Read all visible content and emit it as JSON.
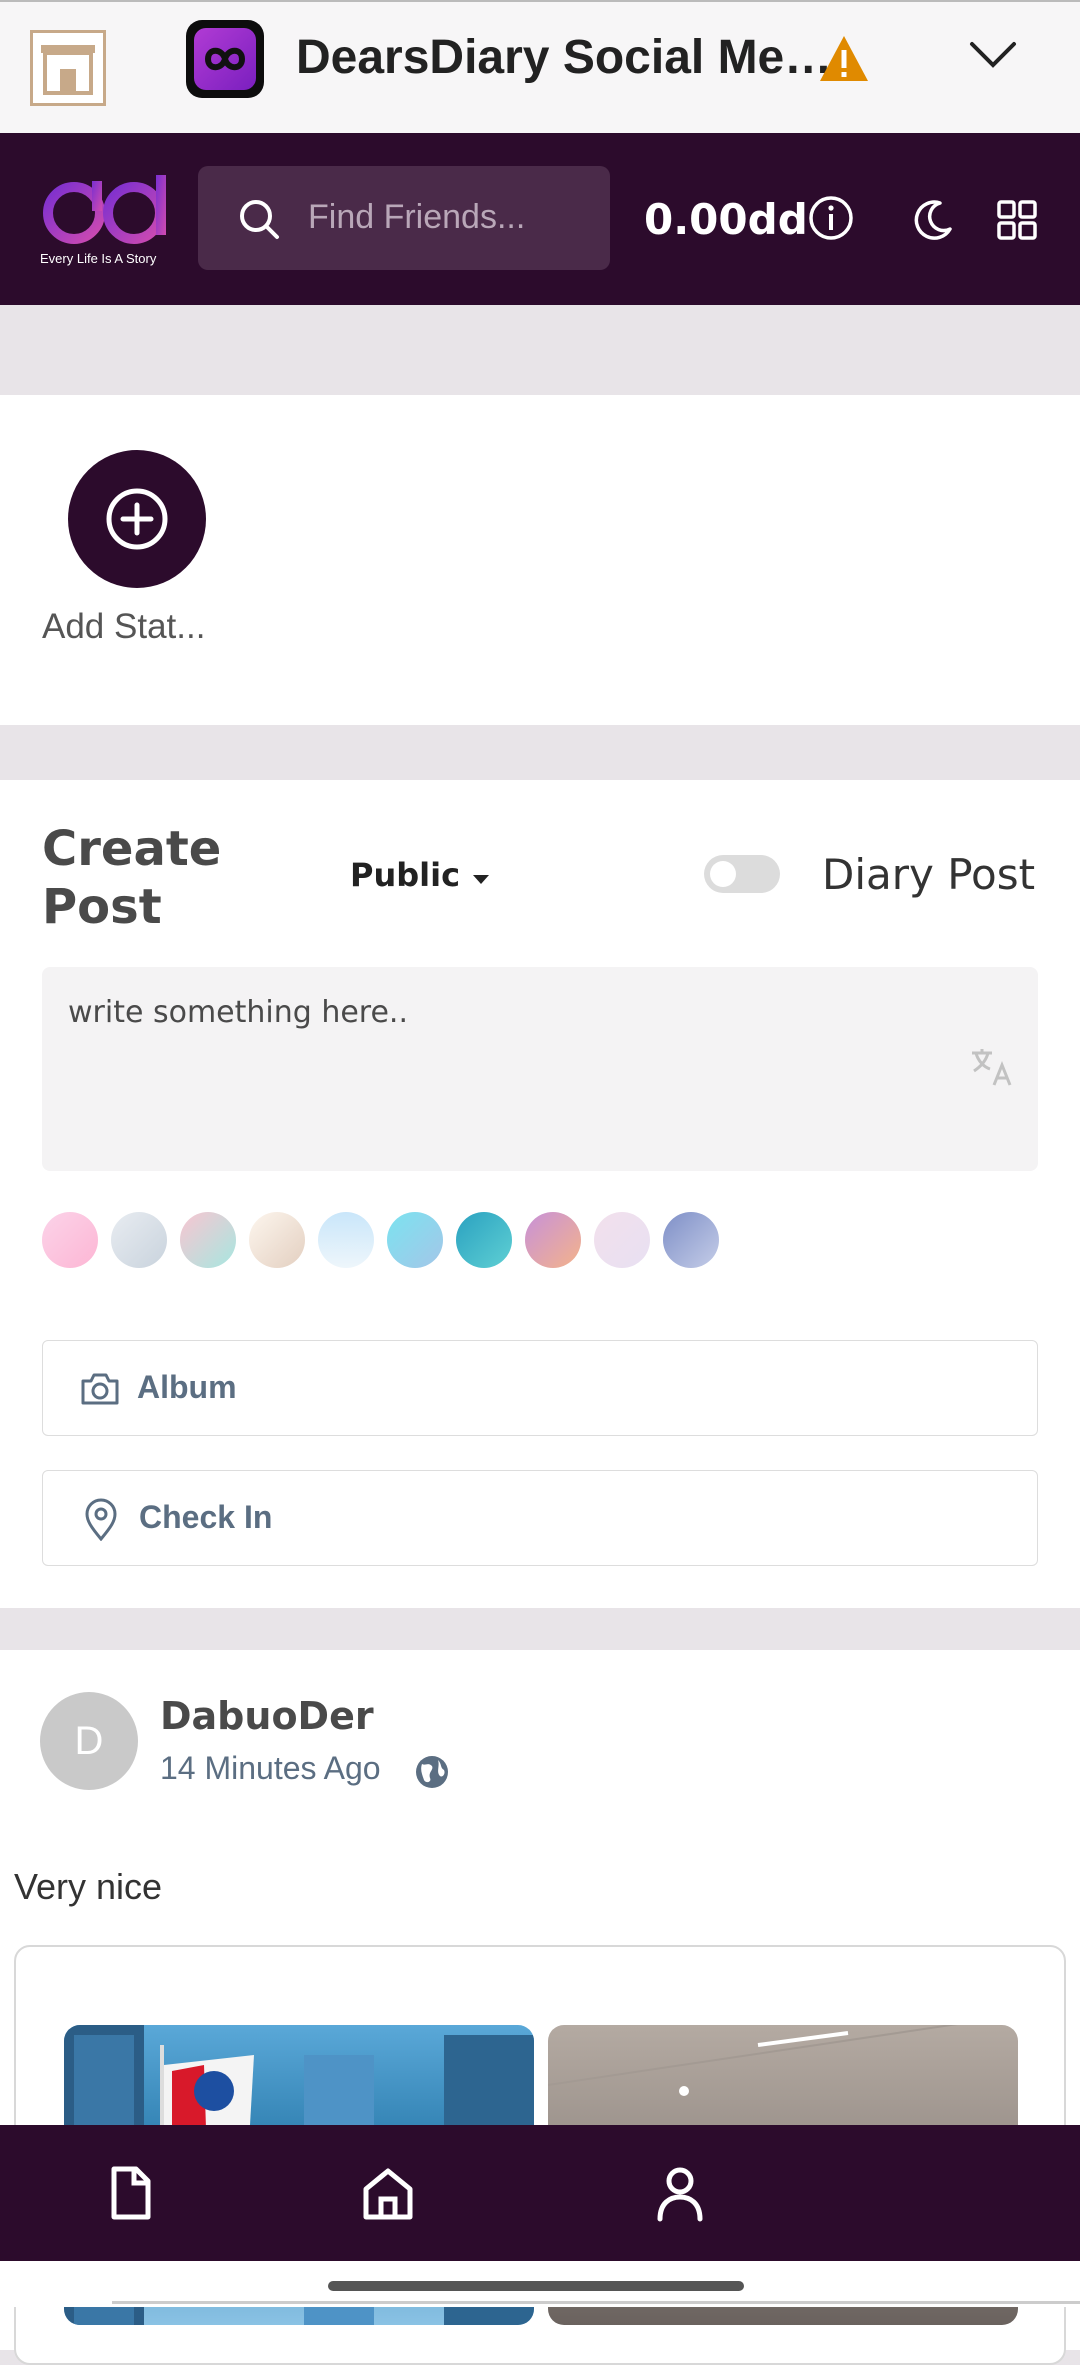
{
  "topbar": {
    "title": "DearsDiary Social Me…"
  },
  "header": {
    "logo_tagline": "Every Life Is A Story",
    "search_placeholder": "Find Friends...",
    "balance": "0.00dd"
  },
  "stories": {
    "add_label": "Add Stat..."
  },
  "create_post": {
    "title": "Create Post",
    "privacy_value": "Public",
    "diary_toggle_label": "Diary Post",
    "diary_toggle_on": false,
    "input_placeholder": "write something here..",
    "background_swatches": [
      "linear-gradient(135deg,#fbd3e9,#fdb6d4)",
      "linear-gradient(135deg,#e8ecf1,#c9d3dd)",
      "linear-gradient(135deg,#f9c5d1,#a6e7e0)",
      "linear-gradient(135deg,#fdf6ee,#e3cfc0)",
      "linear-gradient(180deg,#c9e6fa,#eef6fb)",
      "linear-gradient(135deg,#7be3f0,#a4c6e8)",
      "linear-gradient(135deg,#2aa1c0,#5fd0d4)",
      "linear-gradient(135deg,#c791d9,#f4b38a)",
      "linear-gradient(135deg,#f2e0ec,#e8e0f2)",
      "linear-gradient(135deg,#7e8fc7,#c5cde8)"
    ],
    "album_label": "Album",
    "checkin_label": "Check In"
  },
  "feed": {
    "post": {
      "avatar_letter": "D",
      "author": "DabuoDer",
      "time": "14 Minutes Ago",
      "text": "Very nice"
    }
  },
  "colors": {
    "brand_dark": "#2c0b2c",
    "warning": "#e08a00"
  }
}
